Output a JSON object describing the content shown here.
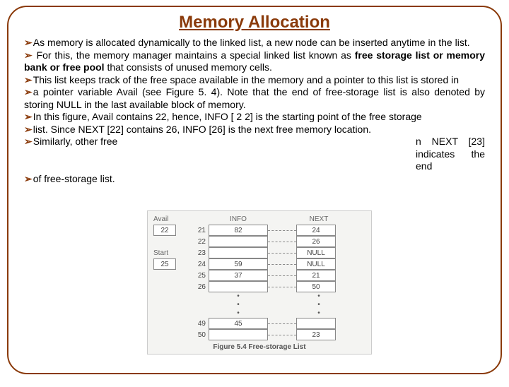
{
  "title": "Memory Allocation",
  "bullets": {
    "b1a": "As memory is allocated dynamically to the linked list, a new node can be inserted anytime in the list.",
    "b2a": " For this, the memory manager maintains a special linked list known as ",
    "b2b": "free storage list or memory bank or free pool",
    "b2c": " that consists of unused memory cells.",
    "b3": "This list keeps track of the free space available in the memory and a pointer to this list is stored in",
    "b4": "a pointer variable Avail (see Figure 5. 4). Note that the end of free-storage list is also denoted by storing NULL in the last available block of memory.",
    "b5": "In this figure, Avail contains 22, hence, INFO [ 2 2] is the starting point of the free storage",
    "b6": "list. Since NEXT [22] contains 26, INFO [26] is the next free memory location.",
    "b7": "Similarly, other free",
    "b7r": "n NEXT [23] indicates the end",
    "b8": "of free-storage list."
  },
  "figure": {
    "avail_label": "Avail",
    "start_label": "Start",
    "avail_val": "22",
    "start_val": "25",
    "info_head": "INFO",
    "next_head": "NEXT",
    "rows": [
      {
        "ix": "21",
        "info": "82",
        "next": "24"
      },
      {
        "ix": "22",
        "info": "",
        "next": "26"
      },
      {
        "ix": "23",
        "info": "",
        "next": "NULL"
      },
      {
        "ix": "24",
        "info": "59",
        "next": "NULL"
      },
      {
        "ix": "25",
        "info": "37",
        "next": "21"
      },
      {
        "ix": "26",
        "info": "",
        "next": "50"
      }
    ],
    "tail": [
      {
        "ix": "49",
        "info": "45",
        "next": ""
      },
      {
        "ix": "50",
        "info": "",
        "next": "23"
      }
    ],
    "caption": "Figure 5.4 Free-storage List"
  }
}
